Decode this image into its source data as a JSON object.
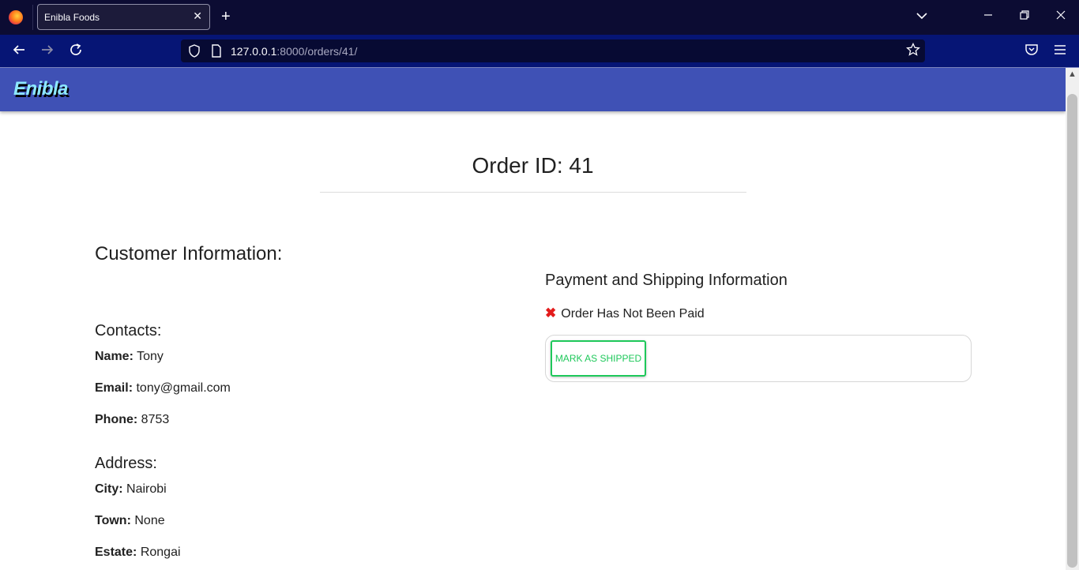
{
  "browser": {
    "tab_title": "Enibla Foods",
    "url_host": "127.0.0.1",
    "url_path": ":8000/orders/41/"
  },
  "app": {
    "brand": "Enibla"
  },
  "order": {
    "title": "Order ID: 41"
  },
  "customer": {
    "heading": "Customer Information:",
    "contacts_heading": "Contacts:",
    "name_label": "Name:",
    "name": "Tony",
    "email_label": "Email:",
    "email": "tony@gmail.com",
    "phone_label": "Phone:",
    "phone": "8753",
    "address_heading": "Address:",
    "city_label": "City:",
    "city": "Nairobi",
    "town_label": "Town:",
    "town": "None",
    "estate_label": "Estate:",
    "estate": "Rongai"
  },
  "payment": {
    "heading": "Payment and Shipping Information",
    "status": "Order Has Not Been Paid",
    "status_icon": "close-x-icon",
    "status_color": "#e31b1b",
    "ship_button": "MARK AS SHIPPED",
    "ship_button_color": "#1ec85a"
  },
  "theme": {
    "header_color": "#3f51b5"
  }
}
